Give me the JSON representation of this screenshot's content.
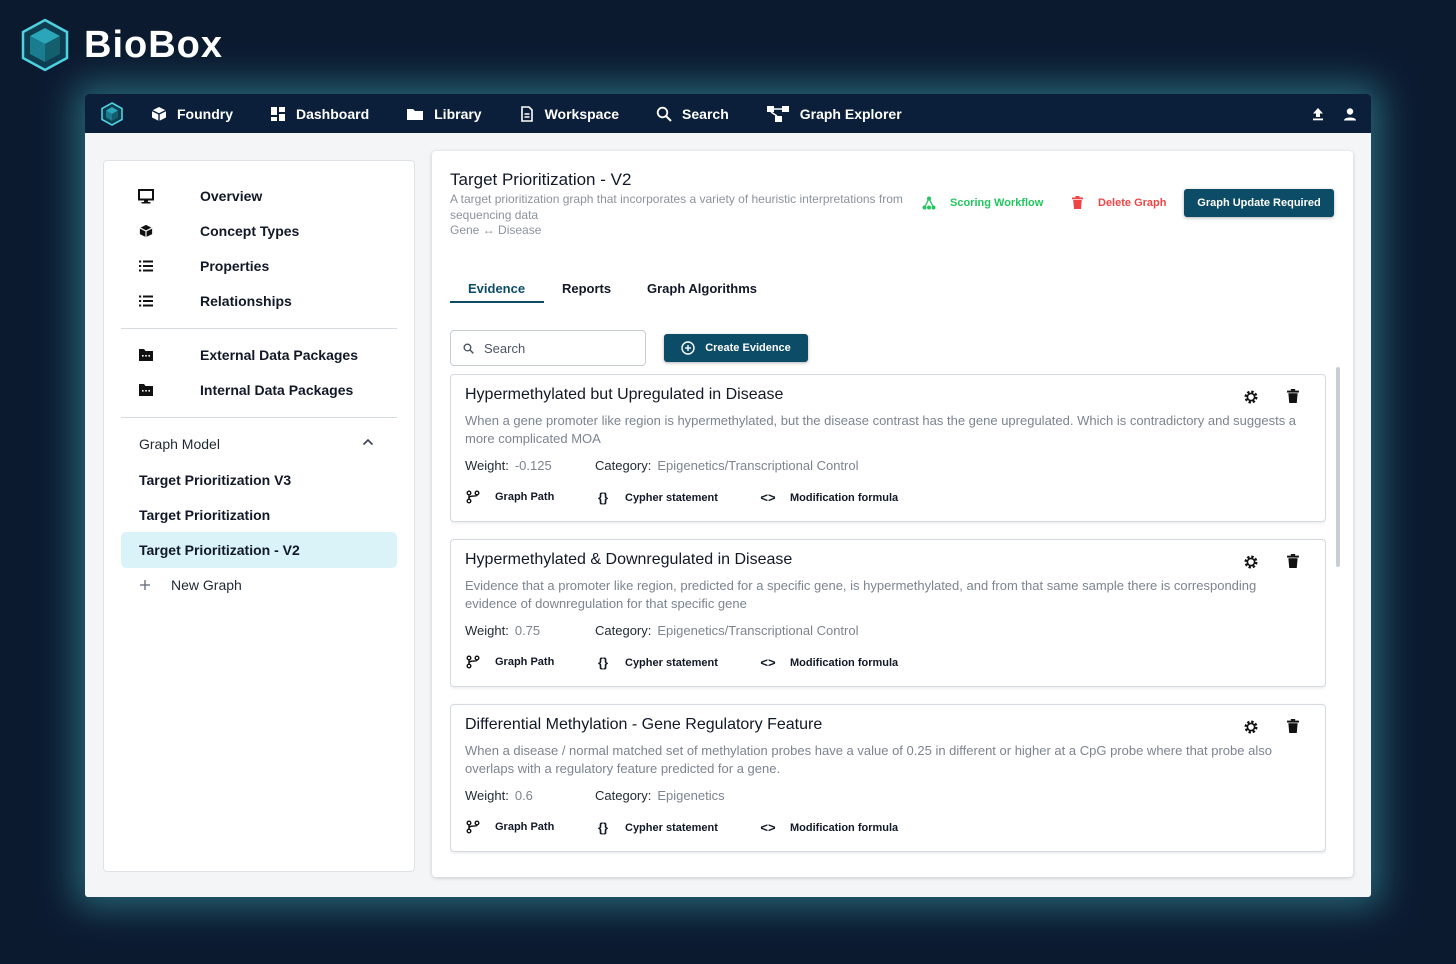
{
  "brand": {
    "name": "BioBox"
  },
  "nav": {
    "items": [
      {
        "label": "Foundry",
        "icon": "cube-icon"
      },
      {
        "label": "Dashboard",
        "icon": "dashboard-icon"
      },
      {
        "label": "Library",
        "icon": "folder-icon"
      },
      {
        "label": "Workspace",
        "icon": "document-icon"
      },
      {
        "label": "Search",
        "icon": "search-icon"
      },
      {
        "label": "Graph Explorer",
        "icon": "graph-icon"
      }
    ],
    "right_icons": [
      "upload-icon",
      "user-icon"
    ]
  },
  "sidebar": {
    "items": [
      {
        "label": "Overview",
        "icon": "monitor-icon"
      },
      {
        "label": "Concept Types",
        "icon": "cube-icon"
      },
      {
        "label": "Properties",
        "icon": "list-icon"
      },
      {
        "label": "Relationships",
        "icon": "list-icon"
      },
      {
        "label": "External Data Packages",
        "icon": "package-icon"
      },
      {
        "label": "Internal Data Packages",
        "icon": "package-icon"
      }
    ],
    "graph_model_label": "Graph Model",
    "graphs": [
      {
        "label": "Target Prioritization V3"
      },
      {
        "label": "Target Prioritization"
      },
      {
        "label": "Target Prioritization - V2",
        "active": true
      }
    ],
    "new_graph_label": "New Graph"
  },
  "header": {
    "title": "Target Prioritization - V2",
    "description": "A target prioritization graph that incorporates a variety of heuristic interpretations from sequencing data",
    "relation": "Gene ↔ Disease",
    "scoring_label": "Scoring Workflow",
    "delete_label": "Delete Graph",
    "update_label": "Graph Update Required"
  },
  "tabs": [
    {
      "label": "Evidence",
      "active": true
    },
    {
      "label": "Reports"
    },
    {
      "label": "Graph Algorithms"
    }
  ],
  "search": {
    "placeholder": "Search"
  },
  "create_label": "Create Evidence",
  "labels": {
    "weight": "Weight:",
    "category": "Category:",
    "graph_path": "Graph Path",
    "cypher": "Cypher statement",
    "modification": "Modification formula"
  },
  "evidence": [
    {
      "title": "Hypermethylated but Upregulated in Disease",
      "description": "When a gene promoter like region is hypermethylated, but the disease contrast has the gene upregulated. Which is contradictory and suggests a more complicated MOA",
      "weight": "-0.125",
      "category": "Epigenetics/Transcriptional Control"
    },
    {
      "title": "Hypermethylated & Downregulated in Disease",
      "description": "Evidence that a promoter like region, predicted for a specific gene, is hypermethylated, and from that same sample there is corresponding evidence of downregulation for that specific gene",
      "weight": "0.75",
      "category": "Epigenetics/Transcriptional Control"
    },
    {
      "title": "Differential Methylation - Gene Regulatory Feature",
      "description": "When a disease / normal matched set of methylation probes have a value of 0.25 in different or higher at a CpG probe where that probe also overlaps with a regulatory feature predicted for a gene.",
      "weight": "0.6",
      "category": "Epigenetics"
    }
  ],
  "colors": {
    "background": "#0c1a30",
    "nav": "#0c1f3a",
    "accent": "#0d4c66",
    "active_bg": "#d9f3f8",
    "scoring": "#22c55e",
    "delete": "#ef4444"
  }
}
